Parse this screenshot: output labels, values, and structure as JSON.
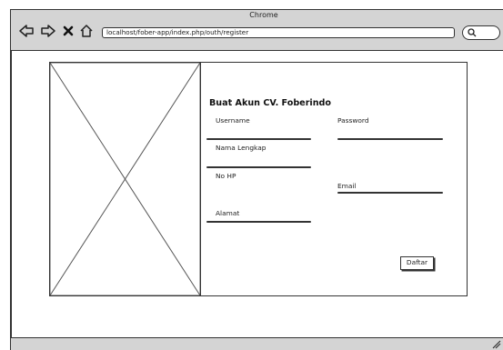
{
  "browser": {
    "title": "Chrome",
    "url": "localhost/fober-app/index.php/outh/register",
    "icons": [
      "back-arrow-icon",
      "forward-arrow-icon",
      "close-icon",
      "home-icon",
      "search-icon",
      "resize-handle-icon"
    ]
  },
  "form": {
    "title": "Buat Akun CV. Foberindo",
    "fields": {
      "username": "Username",
      "password": "Password",
      "nama_lengkap": "Nama Lengkap",
      "no_hp": "No HP",
      "email": "Email",
      "alamat": "Alamat"
    },
    "submit_label": "Daftar"
  }
}
